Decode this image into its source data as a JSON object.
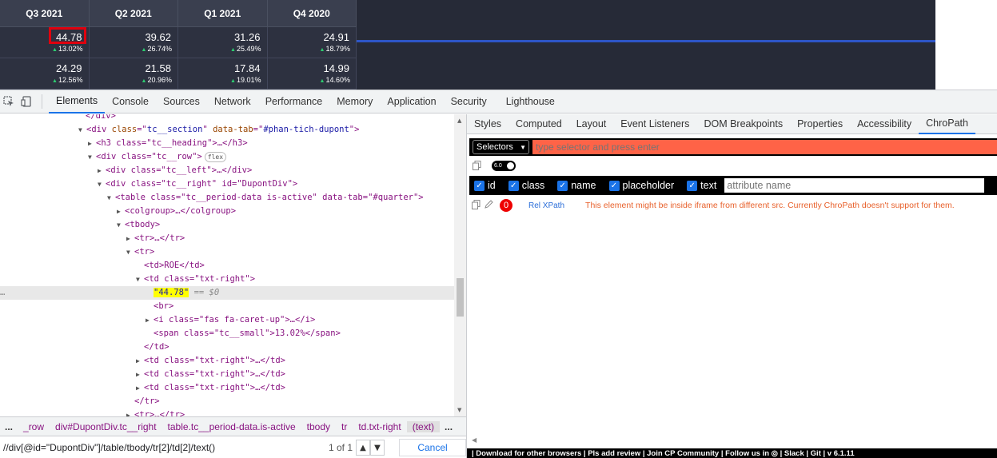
{
  "quarter_table": {
    "headers": [
      "Q3 2021",
      "Q2 2021",
      "Q1 2021",
      "Q4 2020"
    ],
    "rows": [
      [
        {
          "value": "44.78",
          "change": "13.02%"
        },
        {
          "value": "39.62",
          "change": "26.74%"
        },
        {
          "value": "31.26",
          "change": "25.49%"
        },
        {
          "value": "24.91",
          "change": "18.79%"
        }
      ],
      [
        {
          "value": "24.29",
          "change": "12.56%"
        },
        {
          "value": "21.58",
          "change": "20.96%"
        },
        {
          "value": "17.84",
          "change": "19.01%"
        },
        {
          "value": "14.99",
          "change": "14.60%"
        }
      ]
    ],
    "up_caret": "▲"
  },
  "devtools": {
    "tabs": [
      "Elements",
      "Console",
      "Sources",
      "Network",
      "Performance",
      "Memory",
      "Application",
      "Security",
      "Lighthouse"
    ],
    "active_tab": "Elements",
    "sidebar_tabs": [
      "Styles",
      "Computed",
      "Layout",
      "Event Listeners",
      "DOM Breakpoints",
      "Properties",
      "Accessibility",
      "ChroPath"
    ],
    "sidebar_active": "ChroPath"
  },
  "dom": {
    "l0": "</div>",
    "l1_tag": "div",
    "l1_a1": "class",
    "l1_v1": "tc__section",
    "l1_a2": "data-tab",
    "l1_v2": "#phan-tich-dupont",
    "l2": "<h3 class=\"tc__heading\">…</h3>",
    "l3": "<div class=\"tc__row\">",
    "l3_badge": "flex",
    "l4": "<div class=\"tc__left\">…</div>",
    "l5": "<div class=\"tc__right\" id=\"DupontDiv\">",
    "l6": "<table class=\"tc__period-data is-active\" data-tab=\"#quarter\">",
    "l7": "<colgroup>…</colgroup>",
    "l8": "<tbody>",
    "l9": "<tr>…</tr>",
    "l10": "<tr>",
    "l11": "<td>ROE</td>",
    "l12": "<td class=\"txt-right\">",
    "l13_text": "\"44.78\"",
    "l13_eq": "== $0",
    "l14": "<br>",
    "l15": "<i class=\"fas fa-caret-up\">…</i>",
    "l16": "<span class=\"tc__small\">13.02%</span>",
    "l17": "</td>",
    "l18": "<td class=\"txt-right\">…</td>",
    "l19": "<td class=\"txt-right\">…</td>",
    "l20": "<td class=\"txt-right\">…</td>",
    "l21": "</tr>",
    "l22": "<tr>…</tr>",
    "gutter_dots": "…"
  },
  "breadcrumbs": {
    "lead_dots": "...",
    "items": [
      "_row",
      "div#DupontDiv.tc__right",
      "table.tc__period-data.is-active",
      "tbody",
      "tr",
      "td.txt-right",
      "(text)"
    ],
    "tail_dots": "..."
  },
  "search": {
    "query": "//div[@id=\"DupontDiv\"]/table/tbody/tr[2]/td[2]/text()",
    "match_count": "1 of 1",
    "up": "▲",
    "down": "▼",
    "cancel_label": "Cancel"
  },
  "chropath": {
    "select_label": "Selectors",
    "input_placeholder": "type selector and press enter",
    "version": "6.0",
    "attributes": [
      "id",
      "class",
      "name",
      "placeholder",
      "text"
    ],
    "attr_placeholder": "attribute name",
    "result_count": "0",
    "rel_label": "Rel XPath",
    "message": "This element might be inside iframe from different src. Currently ChroPath doesn't support for them.",
    "footer": "| Download for other browsers | Pls add review | Join CP Community | Follow us  in  ◎  | Slack | Git | v 6.1.11"
  }
}
